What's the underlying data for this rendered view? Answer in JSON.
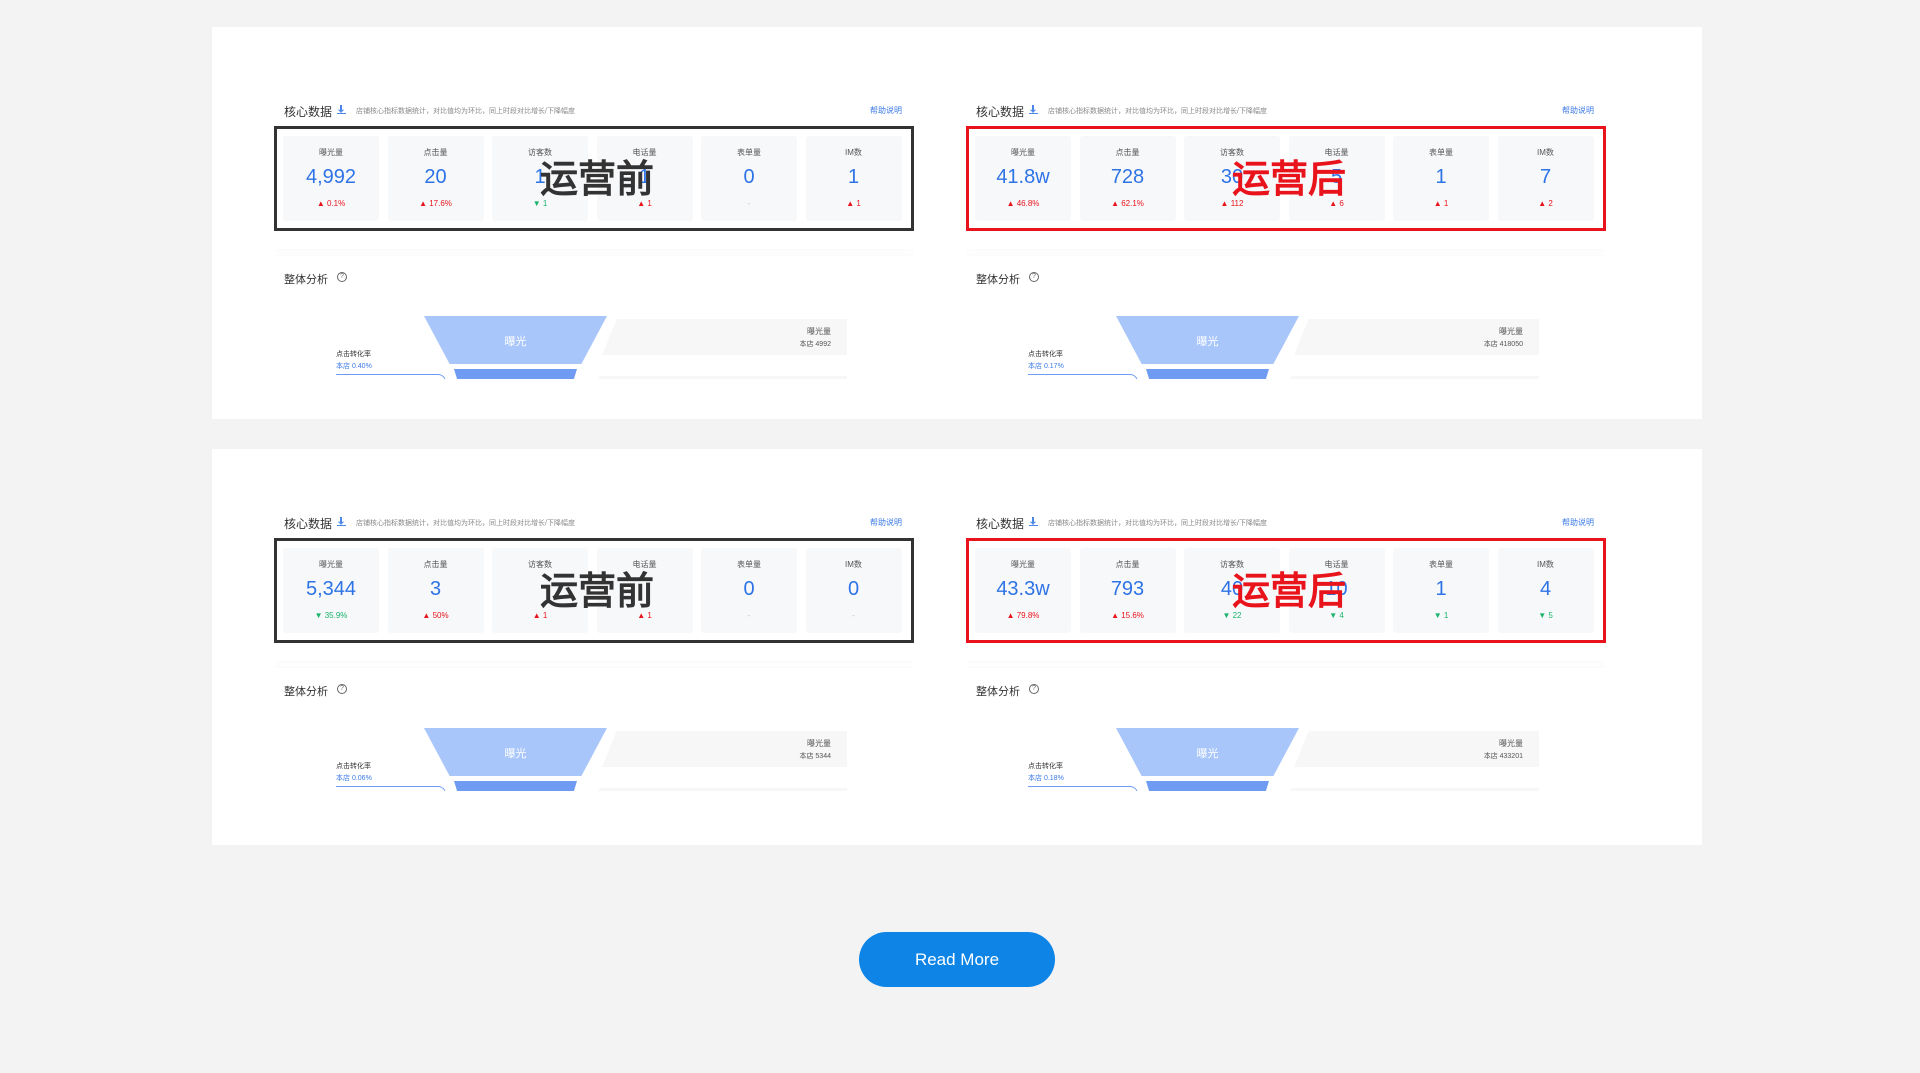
{
  "common": {
    "core_title": "核心数据",
    "core_desc": "店铺核心指标数据统计，对比值均为环比，同上时段对比增长/下降幅度",
    "help": "帮助说明",
    "analysis_title": "整体分析",
    "funnel_top_label": "曝光",
    "info_label": "曝光量",
    "rate_label": "点击转化率",
    "store_prefix": "本店",
    "metric_labels": [
      "曝光量",
      "点击量",
      "访客数",
      "电话量",
      "表单量",
      "IM数"
    ]
  },
  "panels": [
    {
      "overlay": "运营前",
      "style": "dark",
      "metrics": [
        {
          "value": "4,992",
          "change": "0.1%",
          "dir": "up"
        },
        {
          "value": "20",
          "change": "17.6%",
          "dir": "up"
        },
        {
          "value": "1",
          "change": "1",
          "dir": "down"
        },
        {
          "value": "1",
          "change": "1",
          "dir": "up"
        },
        {
          "value": "0",
          "change": "-",
          "dir": "flat"
        },
        {
          "value": "1",
          "change": "1",
          "dir": "up"
        }
      ],
      "info_value": "本店 4992",
      "rate_value": "0.40%"
    },
    {
      "overlay": "运营后",
      "style": "red",
      "metrics": [
        {
          "value": "41.8w",
          "change": "46.8%",
          "dir": "up"
        },
        {
          "value": "728",
          "change": "62.1%",
          "dir": "up"
        },
        {
          "value": "30",
          "change": "112",
          "dir": "up"
        },
        {
          "value": "5",
          "change": "6",
          "dir": "up"
        },
        {
          "value": "1",
          "change": "1",
          "dir": "up"
        },
        {
          "value": "7",
          "change": "2",
          "dir": "up"
        }
      ],
      "info_value": "本店 418050",
      "rate_value": "0.17%"
    },
    {
      "overlay": "运营前",
      "style": "dark",
      "metrics": [
        {
          "value": "5,344",
          "change": "35.9%",
          "dir": "down"
        },
        {
          "value": "3",
          "change": "50%",
          "dir": "up"
        },
        {
          "value": "",
          "change": "1",
          "dir": "up"
        },
        {
          "value": "",
          "change": "1",
          "dir": "up"
        },
        {
          "value": "0",
          "change": "-",
          "dir": "flat"
        },
        {
          "value": "0",
          "change": "-",
          "dir": "flat"
        }
      ],
      "info_value": "本店 5344",
      "rate_value": "0.06%"
    },
    {
      "overlay": "运营后",
      "style": "red",
      "metrics": [
        {
          "value": "43.3w",
          "change": "79.8%",
          "dir": "up"
        },
        {
          "value": "793",
          "change": "15.6%",
          "dir": "up"
        },
        {
          "value": "40",
          "change": "22",
          "dir": "down"
        },
        {
          "value": "10",
          "change": "4",
          "dir": "down"
        },
        {
          "value": "1",
          "change": "1",
          "dir": "down"
        },
        {
          "value": "4",
          "change": "5",
          "dir": "down"
        }
      ],
      "info_value": "本店 433201",
      "rate_value": "0.18%"
    }
  ],
  "read_more": "Read More"
}
